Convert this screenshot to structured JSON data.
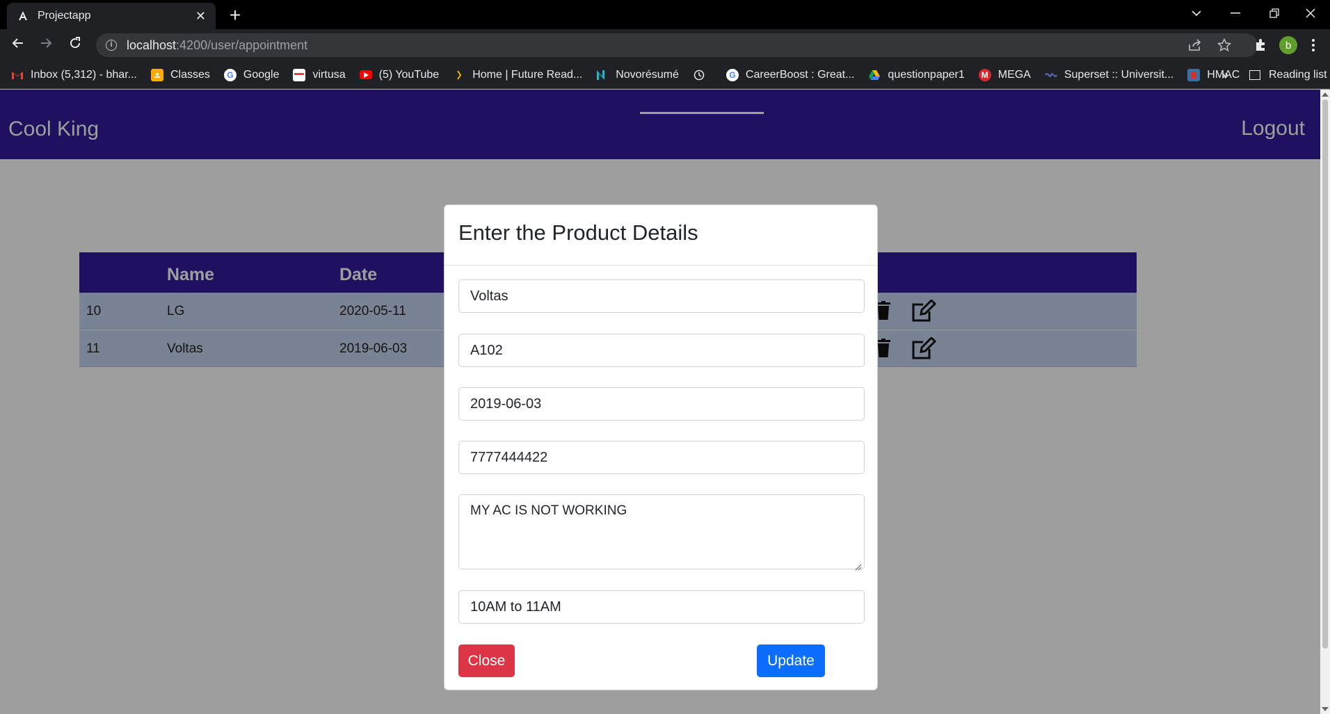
{
  "browser": {
    "tab_title": "Projectapp",
    "url_host": "localhost",
    "url_path": ":4200/user/appointment",
    "profile_initial": "b",
    "bookmarks": [
      {
        "label": "Inbox (5,312) - bhar...",
        "icon": "gmail-icon"
      },
      {
        "label": "Classes",
        "icon": "classroom-icon"
      },
      {
        "label": "Google",
        "icon": "google-icon"
      },
      {
        "label": "virtusa",
        "icon": "virtusa-icon"
      },
      {
        "label": "(5) YouTube",
        "icon": "youtube-icon"
      },
      {
        "label": "Home | Future Read...",
        "icon": "future-ready-icon"
      },
      {
        "label": "Novorésumé",
        "icon": "novoresume-icon"
      },
      {
        "label": "",
        "icon": "history-icon"
      },
      {
        "label": "CareerBoost : Great...",
        "icon": "google-icon"
      },
      {
        "label": "questionpaper1",
        "icon": "drive-icon"
      },
      {
        "label": "MEGA",
        "icon": "mega-icon"
      },
      {
        "label": "Superset :: Universit...",
        "icon": "superset-icon"
      },
      {
        "label": "HMAC",
        "icon": "hmac-icon"
      }
    ],
    "more_bookmarks": "»",
    "reading_list": "Reading list"
  },
  "navbar": {
    "brand": "Cool King",
    "logout": "Logout"
  },
  "table": {
    "headers": [
      "Name",
      "Date"
    ],
    "rows": [
      {
        "id": "10",
        "name": "LG",
        "date": "2020-05-11"
      },
      {
        "id": "11",
        "name": "Voltas",
        "date": "2019-06-03"
      }
    ]
  },
  "modal": {
    "title": "Enter the Product Details",
    "fields": {
      "product_name": "Voltas",
      "model_number": "A102",
      "purchase_date": "2019-06-03",
      "contact_number": "7777444422",
      "problem_description": "MY AC IS NOT WORKING",
      "time_slot": "10AM to 11AM"
    },
    "close_label": "Close",
    "update_label": "Update"
  },
  "colors": {
    "brand_primary": "#331c99",
    "row_bg": "#c5d4ef",
    "danger": "#dc3545",
    "primary": "#0d6efd"
  }
}
